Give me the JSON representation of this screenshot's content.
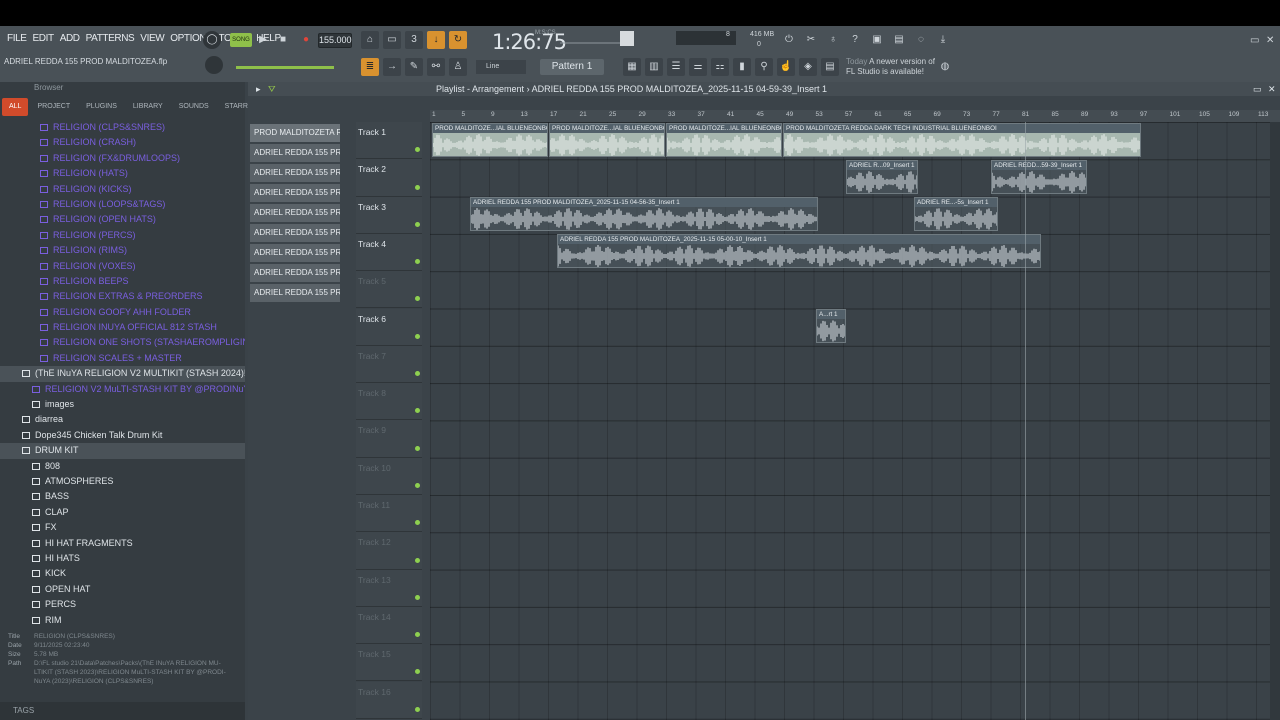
{
  "menu": [
    "FILE",
    "EDIT",
    "ADD",
    "PATTERNS",
    "VIEW",
    "OPTIONS",
    "TOOLS",
    "HELP"
  ],
  "transport": {
    "tempo": "155.000",
    "time": "1:26:75",
    "time_unit": "M:S:CS",
    "pattern": "Pattern 1",
    "cpu": "8",
    "memory": "416 MB",
    "voices": "0"
  },
  "hint": "ADRIEL REDDA 155 PROD MALDITOZEA.flp",
  "snap": "Line",
  "news": {
    "when": "Today",
    "line1": "A newer version of",
    "line2": "FL Studio is available!"
  },
  "browser": {
    "title": "Browser",
    "tabs": [
      "ALL",
      "PROJECT",
      "PLUGINS",
      "LIBRARY",
      "SOUNDS",
      "STARRED"
    ],
    "items": [
      {
        "label": "RELIGION (CLPS&SNRES)",
        "style": "purple",
        "indent": 40
      },
      {
        "label": "RELIGION (CRASH)",
        "style": "purple",
        "indent": 40
      },
      {
        "label": "RELIGION (FX&DRUMLOOPS)",
        "style": "purple",
        "indent": 40
      },
      {
        "label": "RELIGION (HATS)",
        "style": "purple",
        "indent": 40
      },
      {
        "label": "RELIGION (KICKS)",
        "style": "purple",
        "indent": 40
      },
      {
        "label": "RELIGION (LOOPS&TAGS)",
        "style": "purple",
        "indent": 40
      },
      {
        "label": "RELIGION (OPEN HATS)",
        "style": "purple",
        "indent": 40
      },
      {
        "label": "RELIGION (PERCS)",
        "style": "purple",
        "indent": 40
      },
      {
        "label": "RELIGION (RIMS)",
        "style": "purple",
        "indent": 40
      },
      {
        "label": "RELIGION (VOXES)",
        "style": "purple",
        "indent": 40
      },
      {
        "label": "RELIGION BEEPS",
        "style": "purple",
        "indent": 40
      },
      {
        "label": "RELIGION EXTRAS & PREORDERS",
        "style": "purple",
        "indent": 40
      },
      {
        "label": "RELIGION GOOFY AHH FOLDER",
        "style": "purple",
        "indent": 40
      },
      {
        "label": "RELIGION INUYA OFFICIAL 812 STASH",
        "style": "purple",
        "indent": 40
      },
      {
        "label": "RELIGION ONE SHOTS (STASHAEROMPLIGINS)",
        "style": "purple",
        "indent": 40
      },
      {
        "label": "RELIGION SCALES + MASTER",
        "style": "purple",
        "indent": 40
      },
      {
        "label": "(ThE INuYA RELIGION V2 MULTIKIT (STASH 2024)!",
        "style": "bright sel",
        "indent": 22
      },
      {
        "label": "RELIGION V2 MuLTI-STASH KIT BY @PRODINuYA (2024)",
        "style": "purple",
        "indent": 32
      },
      {
        "label": "images",
        "style": "bright",
        "indent": 32
      },
      {
        "label": "diarrea",
        "style": "bright",
        "indent": 22
      },
      {
        "label": "Dope345 Chicken Talk Drum Kit",
        "style": "bright",
        "indent": 22
      },
      {
        "label": "DRUM KIT",
        "style": "bright sel",
        "indent": 22
      },
      {
        "label": "808",
        "style": "bright",
        "indent": 32
      },
      {
        "label": "ATMOSPHERES",
        "style": "bright",
        "indent": 32
      },
      {
        "label": "BASS",
        "style": "bright",
        "indent": 32
      },
      {
        "label": "CLAP",
        "style": "bright",
        "indent": 32
      },
      {
        "label": "FX",
        "style": "bright",
        "indent": 32
      },
      {
        "label": "HI HAT FRAGMENTS",
        "style": "bright",
        "indent": 32
      },
      {
        "label": "HI HATS",
        "style": "bright",
        "indent": 32
      },
      {
        "label": "KICK",
        "style": "bright",
        "indent": 32
      },
      {
        "label": "OPEN HAT",
        "style": "bright",
        "indent": 32
      },
      {
        "label": "PERCS",
        "style": "bright",
        "indent": 32
      },
      {
        "label": "RIM",
        "style": "bright",
        "indent": 32
      }
    ],
    "info": {
      "title_k": "Title",
      "title_v": "RELIGION (CLPS&SNRES)",
      "date_k": "Date",
      "date_v": "9/11/2025 02:23:40",
      "size_k": "Size",
      "size_v": "5.78 MB",
      "path_k": "Path",
      "path_v1": "D:\\FL studio 21\\Data\\Patches\\Packs\\(ThE INuYA RELIGION MU-",
      "path_v2": "LTIKIT (STASH 2023)\\RELIGION MuLTI-STASH KIT BY @PRODI-",
      "path_v3": "NuYA (2023)\\RELIGION (CLPS&SNRES)"
    },
    "tags": "TAGS"
  },
  "playlist": {
    "title": "Playlist - Arrangement",
    "separator": "›",
    "pattern_name": "ADRIEL REDDA 155 PROD MALDITOZEA_2025-11-15 04-59-39_Insert 1",
    "patterns": [
      "PROD MALDITOZETA R...",
      "ADRIEL REDDA 155 PROD...",
      "ADRIEL REDDA 155 PROD...",
      "ADRIEL REDDA 155 PROD...",
      "ADRIEL REDDA 155 PROD...",
      "ADRIEL REDDA 155 PROD...",
      "ADRIEL REDDA 155 PROD...",
      "ADRIEL REDDA 155 PROD...",
      "ADRIEL REDDA 155 PROD..."
    ],
    "ruler": [
      "1",
      "5",
      "9",
      "13",
      "17",
      "21",
      "25",
      "29",
      "33",
      "37",
      "41",
      "45",
      "49",
      "53",
      "57",
      "61",
      "65",
      "69",
      "73",
      "77",
      "81",
      "85",
      "89",
      "93",
      "97",
      "101",
      "105",
      "109",
      "113"
    ],
    "tracks": [
      "Track 1",
      "Track 2",
      "Track 3",
      "Track 4",
      "Track 5",
      "Track 6",
      "Track 7",
      "Track 8",
      "Track 9",
      "Track 10",
      "Track 11",
      "Track 12",
      "Track 13",
      "Track 14",
      "Track 15",
      "Track 16"
    ],
    "clips": {
      "c1": "PROD MALDITOZE...IAL BLUENEONBOI",
      "c2": "PROD MALDITOZE...IAL BLUENEONBOI",
      "c3": "PROD MALDITOZE...IAL BLUENEONBOI",
      "c4": "PROD MALDITOZETA REDDA DARK TECH INDUSTRIAL BLUENEONBOI",
      "c5": "ADRIEL R...09_Insert 1",
      "c6": "ADRIEL REDD...59-39_Insert 1",
      "c7": "ADRIEL REDDA 155 PROD MALDITOZEA_2025-11-15 04-56-35_Insert 1",
      "c8": "ADRIEL RE...-5s_Insert 1",
      "c9": "ADRIEL REDDA 155 PROD MALDITOZEA_2025-11-15 05-00-10_Insert 1",
      "c10": "A...rt 1"
    }
  }
}
